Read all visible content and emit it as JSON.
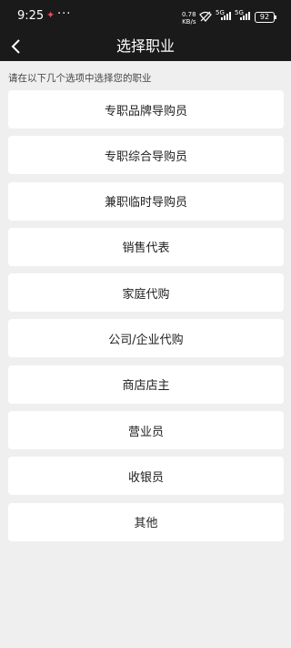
{
  "status_bar": {
    "time": "9:25",
    "speed_value": "0.78",
    "speed_unit": "KB/s",
    "network1": "5G",
    "network2": "5G",
    "battery": "92"
  },
  "nav": {
    "title": "选择职业"
  },
  "hint": "请在以下几个选项中选择您的职业",
  "options": [
    {
      "label": "专职品牌导购员"
    },
    {
      "label": "专职综合导购员"
    },
    {
      "label": "兼职临时导购员"
    },
    {
      "label": "销售代表"
    },
    {
      "label": "家庭代购"
    },
    {
      "label": "公司/企业代购"
    },
    {
      "label": "商店店主"
    },
    {
      "label": "营业员"
    },
    {
      "label": "收银员"
    },
    {
      "label": "其他"
    }
  ]
}
